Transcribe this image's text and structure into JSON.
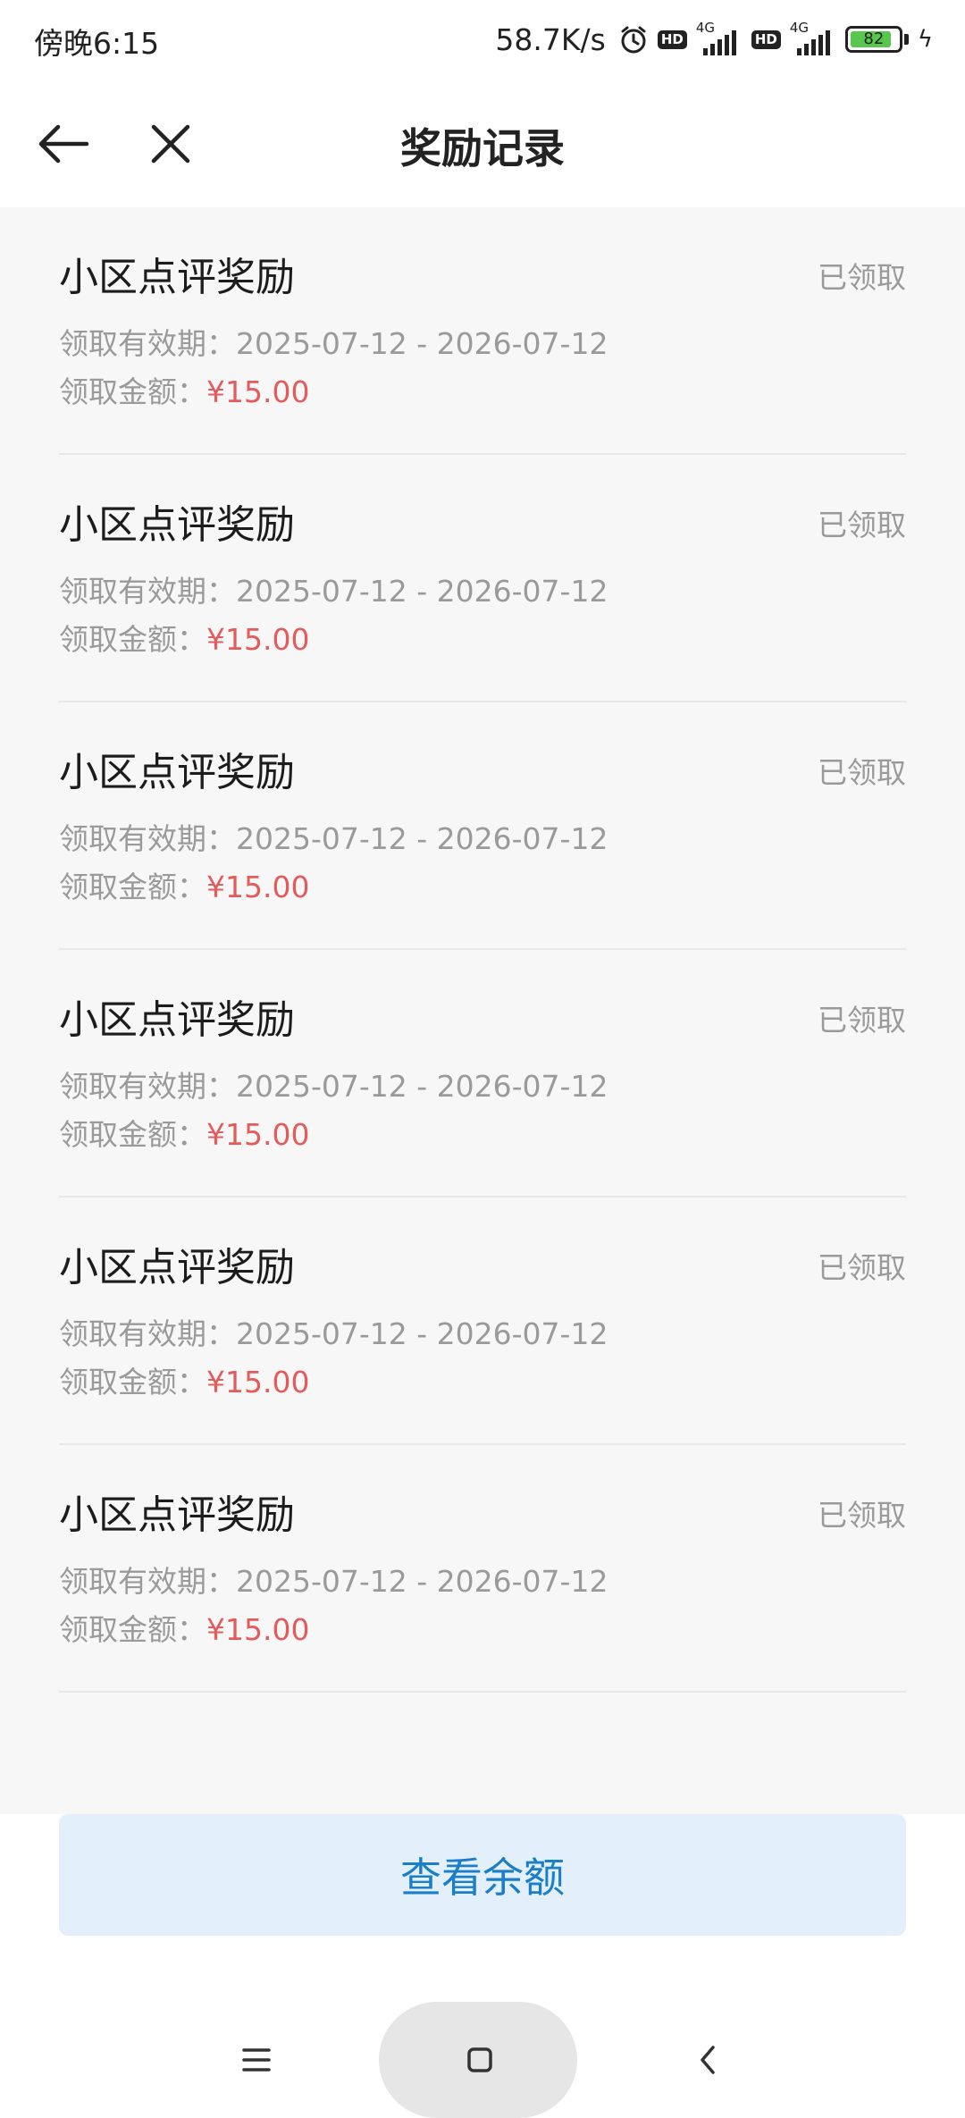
{
  "status_bar": {
    "time": "傍晚6:15",
    "net_speed": "58.7K/s",
    "sim1_hd": "HD",
    "sim1_net": "4G",
    "sim2_hd": "HD",
    "sim2_net": "4G",
    "battery": "82"
  },
  "header": {
    "title": "奖励记录"
  },
  "records": [
    {
      "name": "小区点评奖励",
      "status": "已领取",
      "period_label": "领取有效期：",
      "period": "2025-07-12 - 2026-07-12",
      "amount_label": "领取金额：",
      "amount": "¥15.00"
    },
    {
      "name": "小区点评奖励",
      "status": "已领取",
      "period_label": "领取有效期：",
      "period": "2025-07-12 - 2026-07-12",
      "amount_label": "领取金额：",
      "amount": "¥15.00"
    },
    {
      "name": "小区点评奖励",
      "status": "已领取",
      "period_label": "领取有效期：",
      "period": "2025-07-12 - 2026-07-12",
      "amount_label": "领取金额：",
      "amount": "¥15.00"
    },
    {
      "name": "小区点评奖励",
      "status": "已领取",
      "period_label": "领取有效期：",
      "period": "2025-07-12 - 2026-07-12",
      "amount_label": "领取金额：",
      "amount": "¥15.00"
    },
    {
      "name": "小区点评奖励",
      "status": "已领取",
      "period_label": "领取有效期：",
      "period": "2025-07-12 - 2026-07-12",
      "amount_label": "领取金额：",
      "amount": "¥15.00"
    },
    {
      "name": "小区点评奖励",
      "status": "已领取",
      "period_label": "领取有效期：",
      "period": "2025-07-12 - 2026-07-12",
      "amount_label": "领取金额：",
      "amount": "¥15.00"
    }
  ],
  "footer": {
    "balance_button": "查看余额"
  },
  "icons": {
    "back": "arrow-left-icon",
    "close": "close-icon",
    "menu": "menu-icon",
    "home": "home-square-icon",
    "nav_back": "chevron-left-icon"
  },
  "colors": {
    "price": "#e35b5b",
    "button_bg": "#e3f0fb",
    "button_text": "#1a7ec8",
    "battery": "#57c84d"
  }
}
